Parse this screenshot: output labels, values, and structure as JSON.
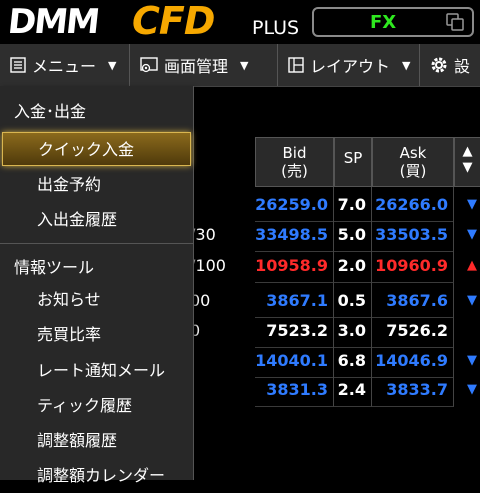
{
  "brand": {
    "logo_dmm": "DMM",
    "logo_cfd": "CFD",
    "logo_plus": "PLUS",
    "mode": "FX"
  },
  "menubar": {
    "menu_label": "メニュー",
    "screen_label": "画面管理",
    "layout_label": "レイアウト",
    "settings_label": "設"
  },
  "table": {
    "headers": {
      "bid_line1": "Bid",
      "bid_line2": "(売)",
      "sp": "SP",
      "ask_line1": "Ask",
      "ask_line2": "(買)"
    },
    "rows": [
      {
        "name": "",
        "bid": "26259.0",
        "sp": "7.0",
        "ask": "26266.0",
        "bid_color": "#2f7bff",
        "ask_color": "#2f7bff",
        "arrow": "▼",
        "arrow_color": "#2f7bff"
      },
      {
        "name": "/30",
        "bid": "33498.5",
        "sp": "5.0",
        "ask": "33503.5",
        "bid_color": "#2f7bff",
        "ask_color": "#2f7bff",
        "arrow": "▼",
        "arrow_color": "#2f7bff"
      },
      {
        "name": "/100",
        "bid": "10958.9",
        "sp": "2.0",
        "ask": "10960.9",
        "bid_color": "#ff2a2a",
        "ask_color": "#ff2a2a",
        "arrow": "▲",
        "arrow_color": "#ff2a2a"
      },
      {
        "name": "00",
        "bid": "3867.1",
        "sp": "0.5",
        "ask": "3867.6",
        "bid_color": "#2f7bff",
        "ask_color": "#2f7bff",
        "arrow": "▼",
        "arrow_color": "#2f7bff"
      },
      {
        "name": "0",
        "bid": "7523.2",
        "sp": "3.0",
        "ask": "7526.2",
        "bid_color": "#ffffff",
        "ask_color": "#ffffff",
        "arrow": "",
        "arrow_color": "#ffffff"
      },
      {
        "name": "",
        "bid": "14040.1",
        "sp": "6.8",
        "ask": "14046.9",
        "bid_color": "#2f7bff",
        "ask_color": "#2f7bff",
        "arrow": "▼",
        "arrow_color": "#2f7bff"
      },
      {
        "name": "",
        "bid": "3831.3",
        "sp": "2.4",
        "ask": "3833.7",
        "bid_color": "#2f7bff",
        "ask_color": "#2f7bff",
        "arrow": "▼",
        "arrow_color": "#2f7bff"
      }
    ]
  },
  "dropdown": {
    "section1": "入金･出金",
    "items1": [
      "クイック入金",
      "出金予約",
      "入出金履歴"
    ],
    "section2": "情報ツール",
    "items2": [
      "お知らせ",
      "売買比率",
      "レート通知メール",
      "ティック履歴",
      "調整額履歴",
      "調整額カレンダー"
    ]
  },
  "colors": {
    "accent": "#f6a800",
    "fx_green": "#2ee81f",
    "bid_blue": "#2f7bff",
    "down_red": "#ff2a2a"
  }
}
